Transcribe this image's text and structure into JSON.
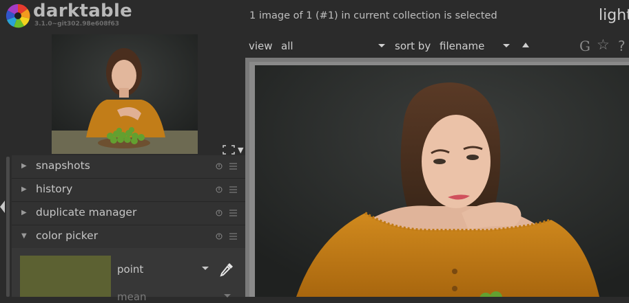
{
  "app": {
    "name": "darktable",
    "version": "3.1.0~git302.98e608f63",
    "view_mode": "light"
  },
  "header": {
    "selection_status": "1 image of 1 (#1) in current collection is selected"
  },
  "filter_bar": {
    "view_label": "view",
    "view_value": "all",
    "sort_label": "sort by",
    "sort_value": "filename",
    "sort_order": "ascending",
    "icons": [
      "grouping-icon",
      "star-icon",
      "help-icon"
    ]
  },
  "navigation": {
    "icons": [
      "zoom-fit-icon",
      "chevron-down-icon"
    ]
  },
  "modules": [
    {
      "label": "snapshots",
      "expanded": false
    },
    {
      "label": "history",
      "expanded": false
    },
    {
      "label": "duplicate manager",
      "expanded": false
    },
    {
      "label": "color picker",
      "expanded": true
    }
  ],
  "color_picker": {
    "mode": "point",
    "statistic": "mean",
    "swatch_color": "#5c6132"
  },
  "colors": {
    "background": "#2b2b2b",
    "module_bg": "#323232",
    "text": "#c8c8c8"
  }
}
